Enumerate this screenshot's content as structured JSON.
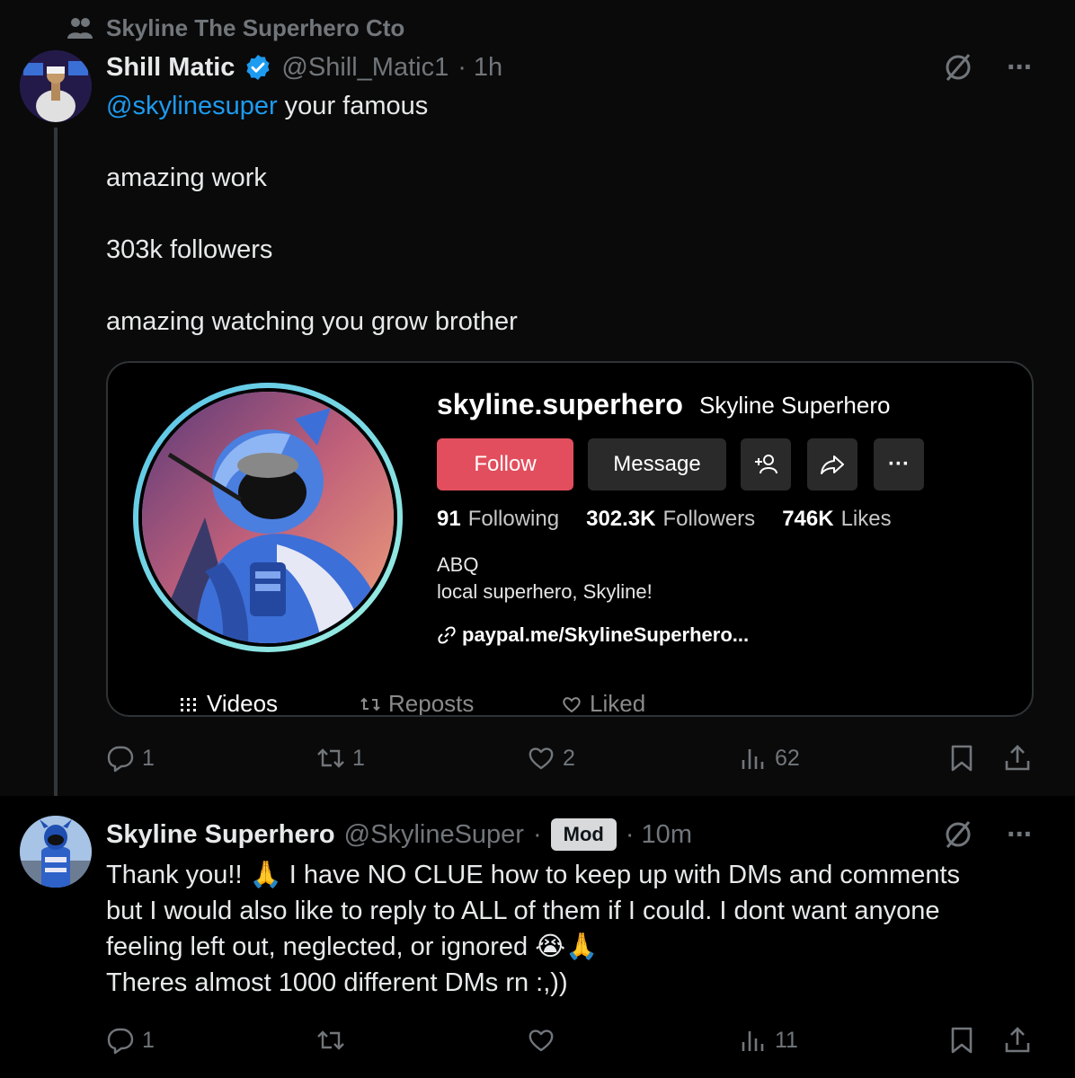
{
  "community": {
    "name": "Skyline The Superhero Cto"
  },
  "post1": {
    "author_name": "Shill Matic",
    "handle": "@Shill_Matic1",
    "time": "· 1h",
    "mention": "@skylinesuper",
    "line1_rest": " your famous",
    "line2": "amazing work",
    "line3": "303k followers",
    "line4": "amazing watching you grow brother",
    "more": "···",
    "card": {
      "username": "skyline.superhero",
      "display_name": "Skyline Superhero",
      "follow_label": "Follow",
      "message_label": "Message",
      "more_label": "···",
      "following_count": "91",
      "following_label": "Following",
      "followers_count": "302.3K",
      "followers_label": "Followers",
      "likes_count": "746K",
      "likes_label": "Likes",
      "bio_line1": "ABQ",
      "bio_line2": "local superhero, Skyline!",
      "link": "paypal.me/SkylineSuperhero...",
      "tabs": {
        "videos": "Videos",
        "reposts": "Reposts",
        "liked": "Liked"
      }
    },
    "actions": {
      "replies": "1",
      "reposts": "1",
      "likes": "2",
      "views": "62"
    }
  },
  "post2": {
    "author_name": "Skyline Superhero",
    "handle": "@SkylineSuper",
    "dot": "·",
    "badge": "Mod",
    "time": "· 10m",
    "more": "···",
    "line1": "Thank you!! 🙏 I have NO CLUE how to keep up with DMs and comments",
    "line2": "but I would also like to reply to ALL of them if I could. I dont want anyone",
    "line3": "feeling left out, neglected, or ignored 😭🙏",
    "line4": "Theres almost 1000 different DMs rn :,))",
    "actions": {
      "replies": "1",
      "views": "11"
    }
  },
  "colors": {
    "accent": "#1d9bf0",
    "follow_button": "#e24e5d",
    "muted": "#71767b"
  }
}
